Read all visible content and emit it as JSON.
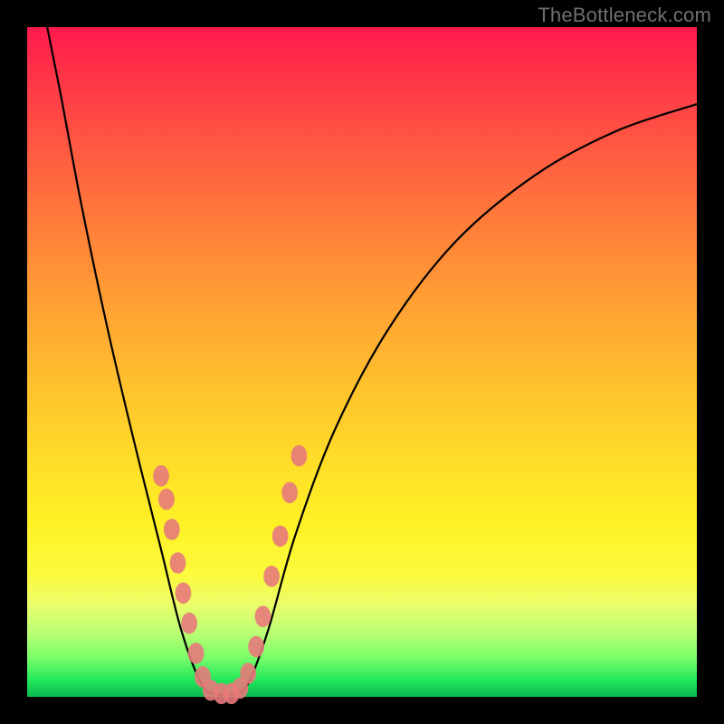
{
  "watermark": "TheBottleneck.com",
  "chart_data": {
    "type": "line",
    "title": "",
    "xlabel": "",
    "ylabel": "",
    "xlim": [
      0,
      100
    ],
    "ylim": [
      0,
      100
    ],
    "background": "rainbow-gradient-vertical",
    "series": [
      {
        "name": "bottleneck-curve",
        "stroke": "#000000",
        "points": [
          {
            "x": 3.0,
            "y": 100.0
          },
          {
            "x": 5.0,
            "y": 90.0
          },
          {
            "x": 8.0,
            "y": 74.0
          },
          {
            "x": 12.0,
            "y": 55.0
          },
          {
            "x": 16.0,
            "y": 38.0
          },
          {
            "x": 20.0,
            "y": 22.0
          },
          {
            "x": 23.0,
            "y": 10.0
          },
          {
            "x": 26.0,
            "y": 2.0
          },
          {
            "x": 28.0,
            "y": 0.5
          },
          {
            "x": 31.0,
            "y": 0.5
          },
          {
            "x": 33.0,
            "y": 2.0
          },
          {
            "x": 36.0,
            "y": 10.0
          },
          {
            "x": 40.0,
            "y": 24.0
          },
          {
            "x": 46.0,
            "y": 40.0
          },
          {
            "x": 54.0,
            "y": 55.0
          },
          {
            "x": 64.0,
            "y": 68.0
          },
          {
            "x": 76.0,
            "y": 78.0
          },
          {
            "x": 88.0,
            "y": 84.5
          },
          {
            "x": 100.0,
            "y": 88.5
          }
        ]
      }
    ],
    "markers": {
      "name": "highlight-dots",
      "fill": "#e77a7b",
      "approx_rx": 1.2,
      "approx_ry": 1.6,
      "points": [
        {
          "x": 20.0,
          "y": 33.0
        },
        {
          "x": 20.8,
          "y": 29.5
        },
        {
          "x": 21.6,
          "y": 25.0
        },
        {
          "x": 22.5,
          "y": 20.0
        },
        {
          "x": 23.3,
          "y": 15.5
        },
        {
          "x": 24.2,
          "y": 11.0
        },
        {
          "x": 25.2,
          "y": 6.5
        },
        {
          "x": 26.2,
          "y": 3.0
        },
        {
          "x": 27.4,
          "y": 1.0
        },
        {
          "x": 29.0,
          "y": 0.5
        },
        {
          "x": 30.5,
          "y": 0.5
        },
        {
          "x": 31.8,
          "y": 1.3
        },
        {
          "x": 33.0,
          "y": 3.5
        },
        {
          "x": 34.2,
          "y": 7.5
        },
        {
          "x": 35.2,
          "y": 12.0
        },
        {
          "x": 36.5,
          "y": 18.0
        },
        {
          "x": 37.8,
          "y": 24.0
        },
        {
          "x": 39.2,
          "y": 30.5
        },
        {
          "x": 40.6,
          "y": 36.0
        }
      ]
    }
  }
}
